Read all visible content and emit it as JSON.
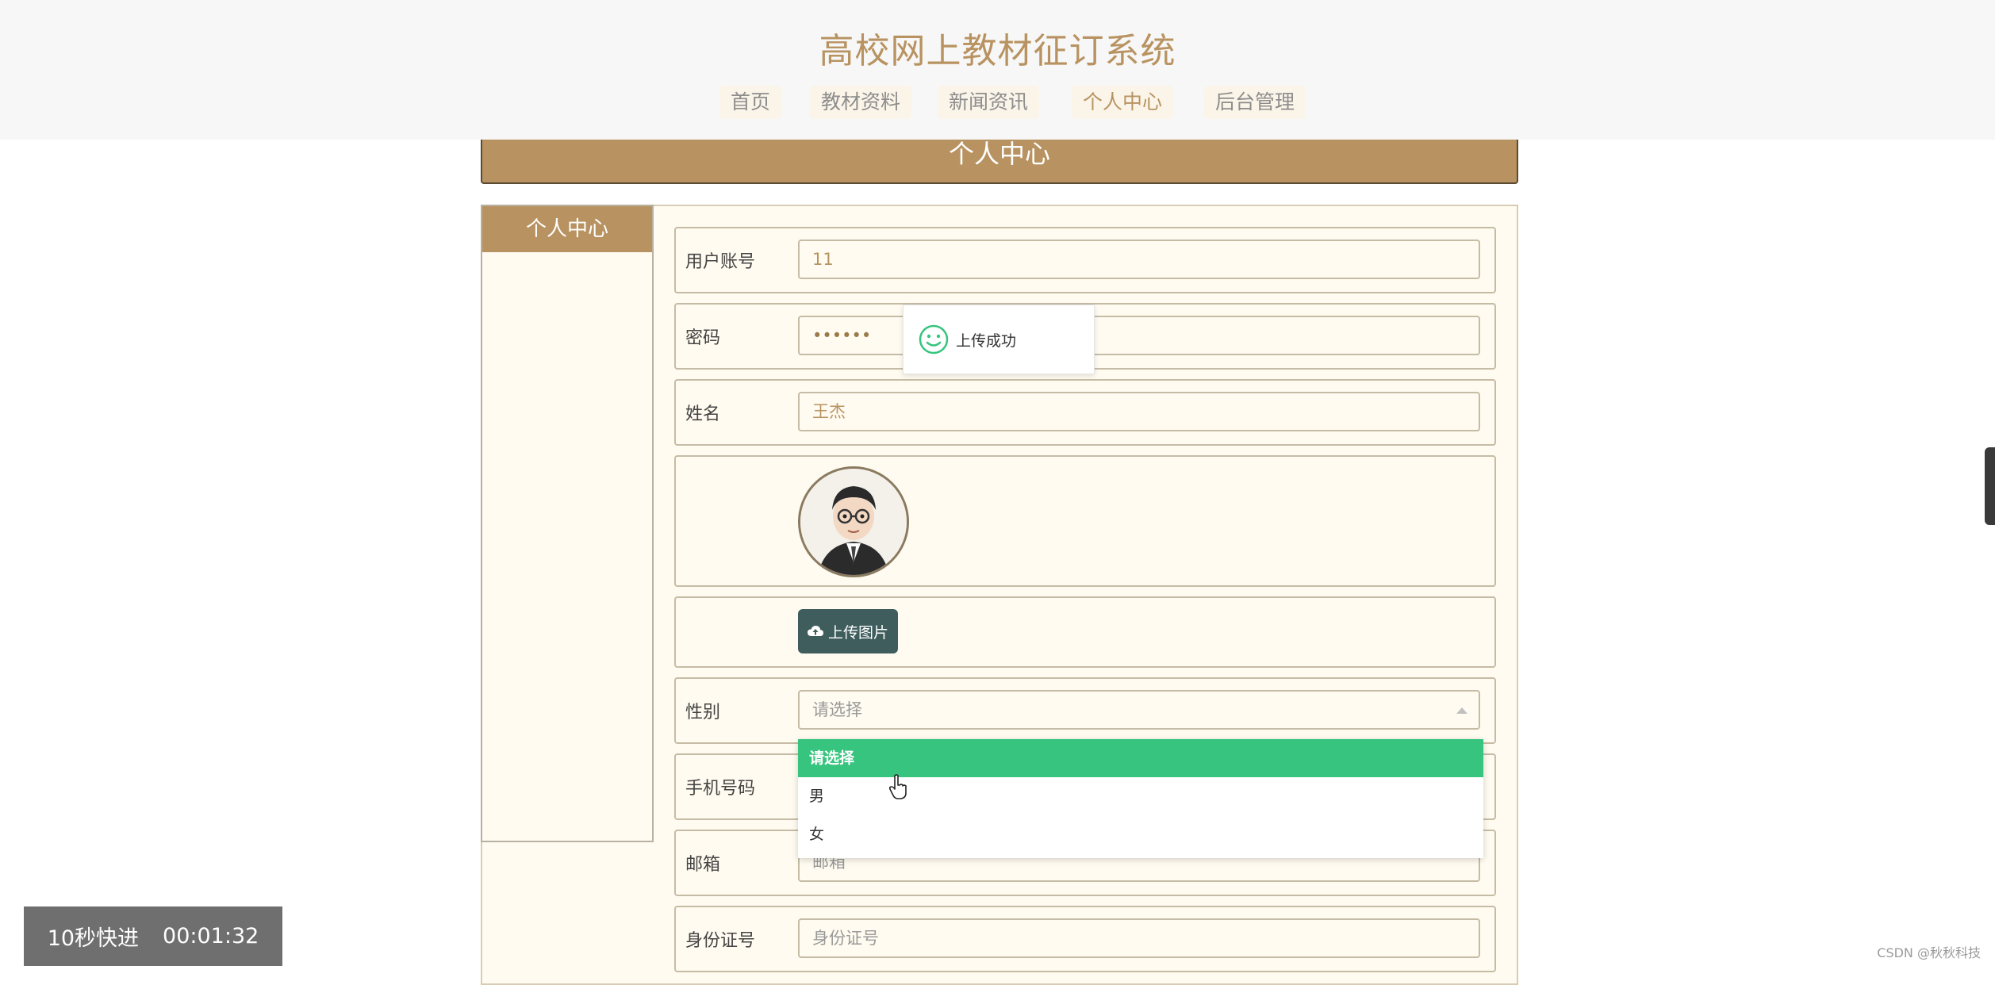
{
  "header": {
    "title": "高校网上教材征订系统",
    "nav": [
      "首页",
      "教材资料",
      "新闻资讯",
      "个人中心",
      "后台管理"
    ],
    "active_index": 3
  },
  "banner": {
    "title": "个人中心"
  },
  "sidebar": {
    "title": "个人中心"
  },
  "form": {
    "username": {
      "label": "用户账号",
      "value": "11"
    },
    "password": {
      "label": "密码",
      "value": "••••••"
    },
    "name": {
      "label": "姓名",
      "value": "王杰"
    },
    "upload_button": "上传图片",
    "gender": {
      "label": "性别",
      "value": "请选择",
      "options": [
        "请选择",
        "男",
        "女"
      ]
    },
    "phone": {
      "label": "手机号码"
    },
    "email": {
      "label": "邮箱",
      "placeholder": "邮箱"
    },
    "idcard": {
      "label": "身份证号",
      "placeholder": "身份证号"
    }
  },
  "toast": {
    "message": "上传成功"
  },
  "video": {
    "skip_label": "10秒快进",
    "time": "00:01:32"
  },
  "watermark": "CSDN @秋秋科技",
  "colors": {
    "accent": "#b89361",
    "selected": "#36c47e",
    "upload_button": "#3f5d5d"
  }
}
